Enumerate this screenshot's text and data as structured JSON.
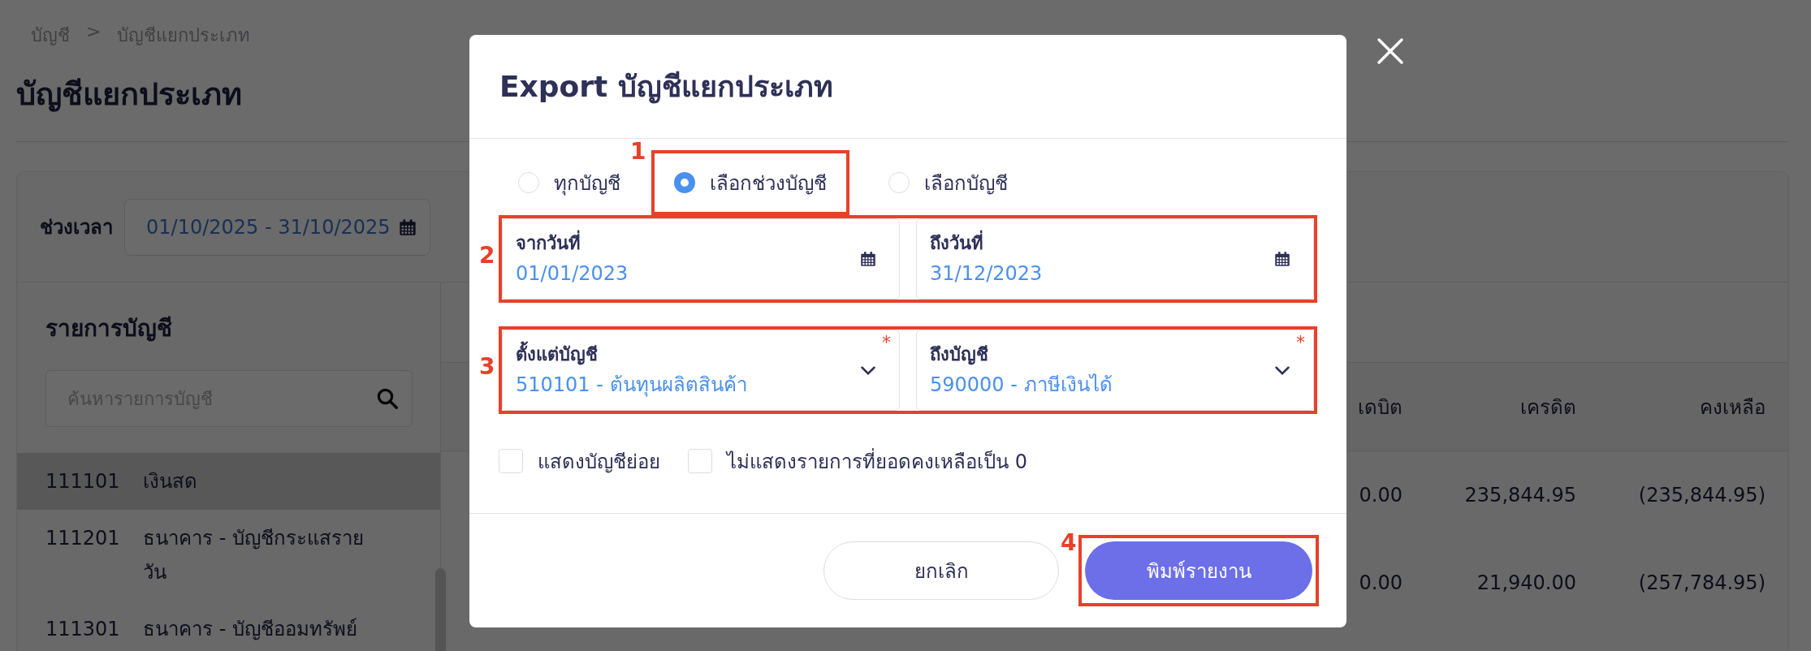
{
  "breadcrumb": {
    "items": [
      "บัญชี",
      "บัญชีแยกประเภท"
    ],
    "separator": ">"
  },
  "page_title": "บัญชีแยกประเภท",
  "period": {
    "label": "ช่วงเวลา",
    "value": "01/10/2025 - 31/10/2025"
  },
  "account_list": {
    "title": "รายการบัญชี",
    "search": {
      "placeholder": "ค้นหารายการบัญชี"
    },
    "items": [
      {
        "code": "111101",
        "name": "เงินสด",
        "selected": true
      },
      {
        "code": "111201",
        "name": "ธนาคาร - บัญชีกระแสราย วัน",
        "selected": false
      },
      {
        "code": "111301",
        "name": "ธนาคาร - บัญชีออมทรัพย์",
        "selected": false
      }
    ]
  },
  "ledger_table": {
    "columns": [
      "เดบิต",
      "เครดิต",
      "คงเหลือ"
    ],
    "rows": [
      [
        "0.00",
        "235,844.95",
        "(235,844.95)"
      ],
      [
        "0.00",
        "21,940.00",
        "(257,784.95)"
      ]
    ]
  },
  "dialog": {
    "title": "Export บัญชีแยกประเภท",
    "scope_options": [
      {
        "label": "ทุกบัญชี",
        "selected": false
      },
      {
        "label": "เลือกช่วงบัญชี",
        "selected": true,
        "annotation": "1"
      },
      {
        "label": "เลือกบัญชี",
        "selected": false
      }
    ],
    "dates_annotation": "2",
    "accounts_annotation": "3",
    "date_fields": [
      {
        "label": "จากวันที่",
        "value": "01/01/2023"
      },
      {
        "label": "ถึงวันที่",
        "value": "31/12/2023"
      }
    ],
    "account_fields": [
      {
        "label": "ตั้งแต่บัญชี",
        "value": "510101 - ต้นทุนผลิตสินค้า",
        "required_mark": "*"
      },
      {
        "label": "ถึงบัญชี",
        "value": "590000 - ภาษีเงินได้",
        "required_mark": "*"
      }
    ],
    "checkboxes": [
      {
        "label": "แสดงบัญชีย่อย",
        "checked": false
      },
      {
        "label": "ไม่แสดงรายการที่ยอดคงเหลือเป็น 0",
        "checked": false
      }
    ],
    "buttons": [
      {
        "label": "ยกเลิก",
        "kind": "secondary"
      },
      {
        "label": "พิมพ์รายงาน",
        "kind": "primary",
        "annotation": "4"
      }
    ]
  }
}
